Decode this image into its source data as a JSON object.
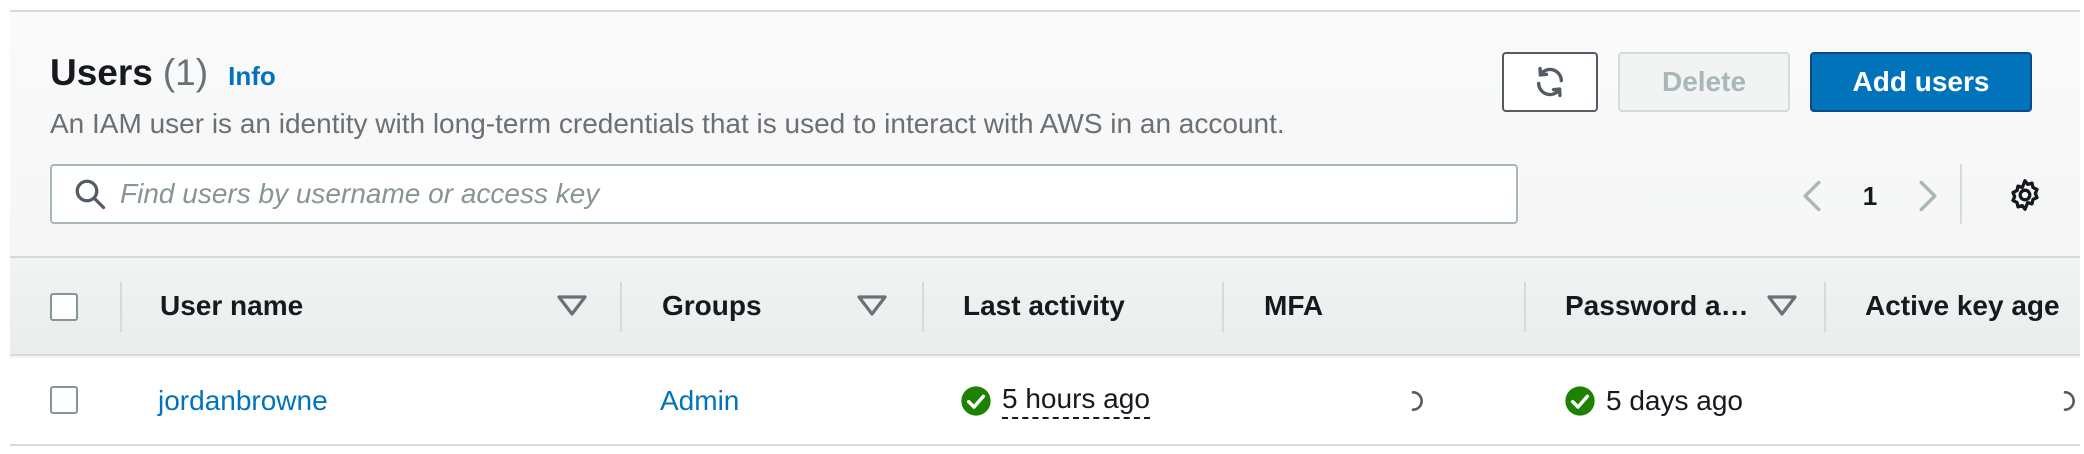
{
  "header": {
    "title": "Users",
    "count": "(1)",
    "info_label": "Info",
    "description": "An IAM user is an identity with long-term credentials that is used to interact with AWS in an account."
  },
  "toolbar": {
    "refresh_icon": "refresh-icon",
    "delete_label": "Delete",
    "add_label": "Add users"
  },
  "search": {
    "placeholder": "Find users by username or access key",
    "value": ""
  },
  "pagination": {
    "current_page": "1"
  },
  "table": {
    "columns": [
      {
        "label": "User name",
        "sortable": true
      },
      {
        "label": "Groups",
        "sortable": true
      },
      {
        "label": "Last activity",
        "sortable": false
      },
      {
        "label": "MFA",
        "sortable": false
      },
      {
        "label": "Password a…",
        "sortable": true
      },
      {
        "label": "Active key age",
        "sortable": false
      }
    ],
    "rows": [
      {
        "user_name": "jordanbrowne",
        "groups": "Admin",
        "last_activity": "5 hours ago",
        "mfa": "",
        "password_age": "5 days ago",
        "active_key_age": ""
      }
    ]
  },
  "colors": {
    "accent": "#0073bb",
    "success": "#1d8102",
    "muted_text": "#687078",
    "border": "#d5dbdb"
  }
}
